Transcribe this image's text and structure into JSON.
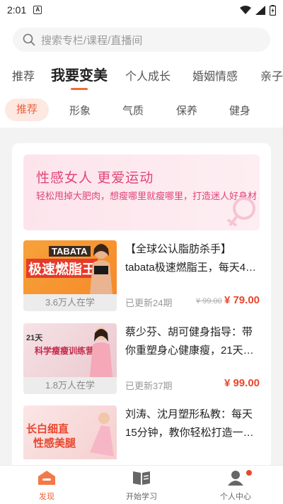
{
  "status_bar": {
    "time": "2:01",
    "notification_glyph": "A"
  },
  "search": {
    "placeholder": "搜索专栏/课程/直播间"
  },
  "main_tabs": [
    "推荐",
    "我要变美",
    "个人成长",
    "婚姻情感",
    "亲子"
  ],
  "main_tab_active": "我要变美",
  "sub_tabs": [
    "推荐",
    "形象",
    "气质",
    "保养",
    "健身"
  ],
  "sub_tab_active": "推荐",
  "banner": {
    "title": "性感女人 更爱运动",
    "subtitle": "轻松甩掉大肥肉，想瘦哪里就瘦哪里，打造迷人好身材"
  },
  "courses": [
    {
      "title": "【全球公认脂肪杀手】tabata极速燃脂王，每天4…",
      "learners": "3.6万人在学",
      "updated": "已更新24期",
      "original_price": "¥ 99.00",
      "price": "¥ 79.00",
      "thumb_text": {
        "top": "TABATA",
        "main": "极速燃脂王"
      }
    },
    {
      "title": "蔡少芬、胡可健身指导：带你重塑身心健康瘦，21天…",
      "learners": "1.8万人在学",
      "updated": "已更新37期",
      "original_price": "",
      "price": "¥ 99.00",
      "thumb_text": {
        "top": "21天",
        "main": "科学瘦瘦训练营"
      }
    },
    {
      "title": "刘涛、沈月塑形私教：每天15分钟，教你轻松打造一…",
      "learners": "",
      "updated": "",
      "original_price": "",
      "price": "",
      "thumb_text": {
        "top": "长白细直",
        "main": "性感美腿"
      }
    }
  ],
  "bottom_nav": [
    {
      "label": "发现",
      "icon": "home-icon",
      "active": true
    },
    {
      "label": "开始学习",
      "icon": "book-icon",
      "active": false
    },
    {
      "label": "个人中心",
      "icon": "user-icon",
      "active": false
    }
  ],
  "colors": {
    "accent": "#f0603a",
    "price": "#e8472f",
    "banner_text": "#e0447a"
  }
}
